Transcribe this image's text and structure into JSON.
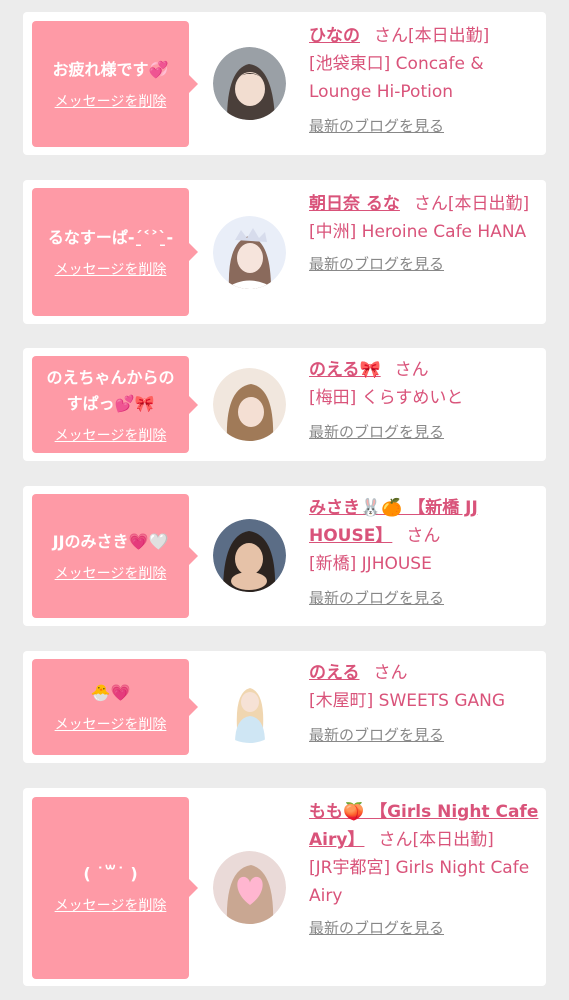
{
  "delete_label": "メッセージを削除",
  "blog_label": "最新のブログを見る",
  "san": "さん",
  "colors": {
    "background": "#ececec",
    "card": "#ffffff",
    "bubble": "#fe9aa6",
    "accent_text": "#d9537a",
    "link_gray": "#888888"
  },
  "cards": [
    {
      "message": "お疲れ様です💞",
      "name": "ひなの",
      "suffix": "[本日出勤]",
      "shop": "[池袋東口] Concafe & Lounge Hi-Potion"
    },
    {
      "message": "るなすーぱ-ˊ̱˂˃ˋ̱-",
      "name": "朝日奈 るな",
      "suffix": "[本日出勤]",
      "shop": "[中洲] Heroine Cafe HANA"
    },
    {
      "message": "のえちゃんからのすぱっ💕🎀",
      "name": "のえる🎀",
      "suffix": "",
      "shop": "[梅田] くらすめいと"
    },
    {
      "message": "JJのみさき💗🤍",
      "name": "みさき🐰🍊 【新橋 JJ HOUSE】",
      "suffix": "",
      "shop": "[新橋] JJHOUSE"
    },
    {
      "message": "🐣💗",
      "name": "のえる",
      "suffix": "",
      "shop": "[木屋町] SWEETS GANG"
    },
    {
      "message": "( ˙꒳˙ )",
      "name": "もも🍑 【Girls Night Cafe Airy】",
      "suffix": "[本日出勤]",
      "shop": "[JR宇都宮] Girls Night Cafe Airy"
    }
  ]
}
